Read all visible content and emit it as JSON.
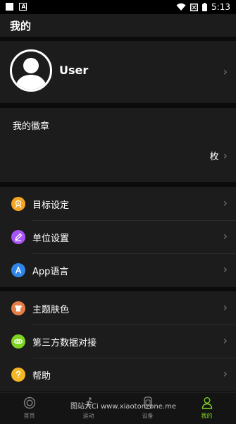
{
  "status_bar": {
    "time": "5:13"
  },
  "header": {
    "title": "我的"
  },
  "profile": {
    "name": "User"
  },
  "badges": {
    "title": "我的徽章",
    "unit": "枚"
  },
  "menu_group_1": [
    {
      "label": "目标设定",
      "icon": "target-icon",
      "color": "#f5a623"
    },
    {
      "label": "单位设置",
      "icon": "pencil-icon",
      "color": "#a855f7"
    },
    {
      "label": "App语言",
      "icon": "language-a-icon",
      "color": "#2f86e8"
    }
  ],
  "menu_group_2": [
    {
      "label": "主题肤色",
      "icon": "shirt-icon",
      "color": "#e67e4a"
    },
    {
      "label": "第三方数据对接",
      "icon": "link-icon",
      "color": "#7ed321"
    },
    {
      "label": "帮助",
      "icon": "question-icon",
      "color": "#f5b623"
    }
  ],
  "bottom_nav": [
    {
      "label": "首页",
      "icon": "home-icon"
    },
    {
      "label": "运动",
      "icon": "run-icon"
    },
    {
      "label": "设备",
      "icon": "device-icon"
    },
    {
      "label": "我的",
      "icon": "person-icon",
      "active": true
    }
  ],
  "accent_color": "#7ed321",
  "watermark": "图站大Ci www.xiaotonzone.me"
}
